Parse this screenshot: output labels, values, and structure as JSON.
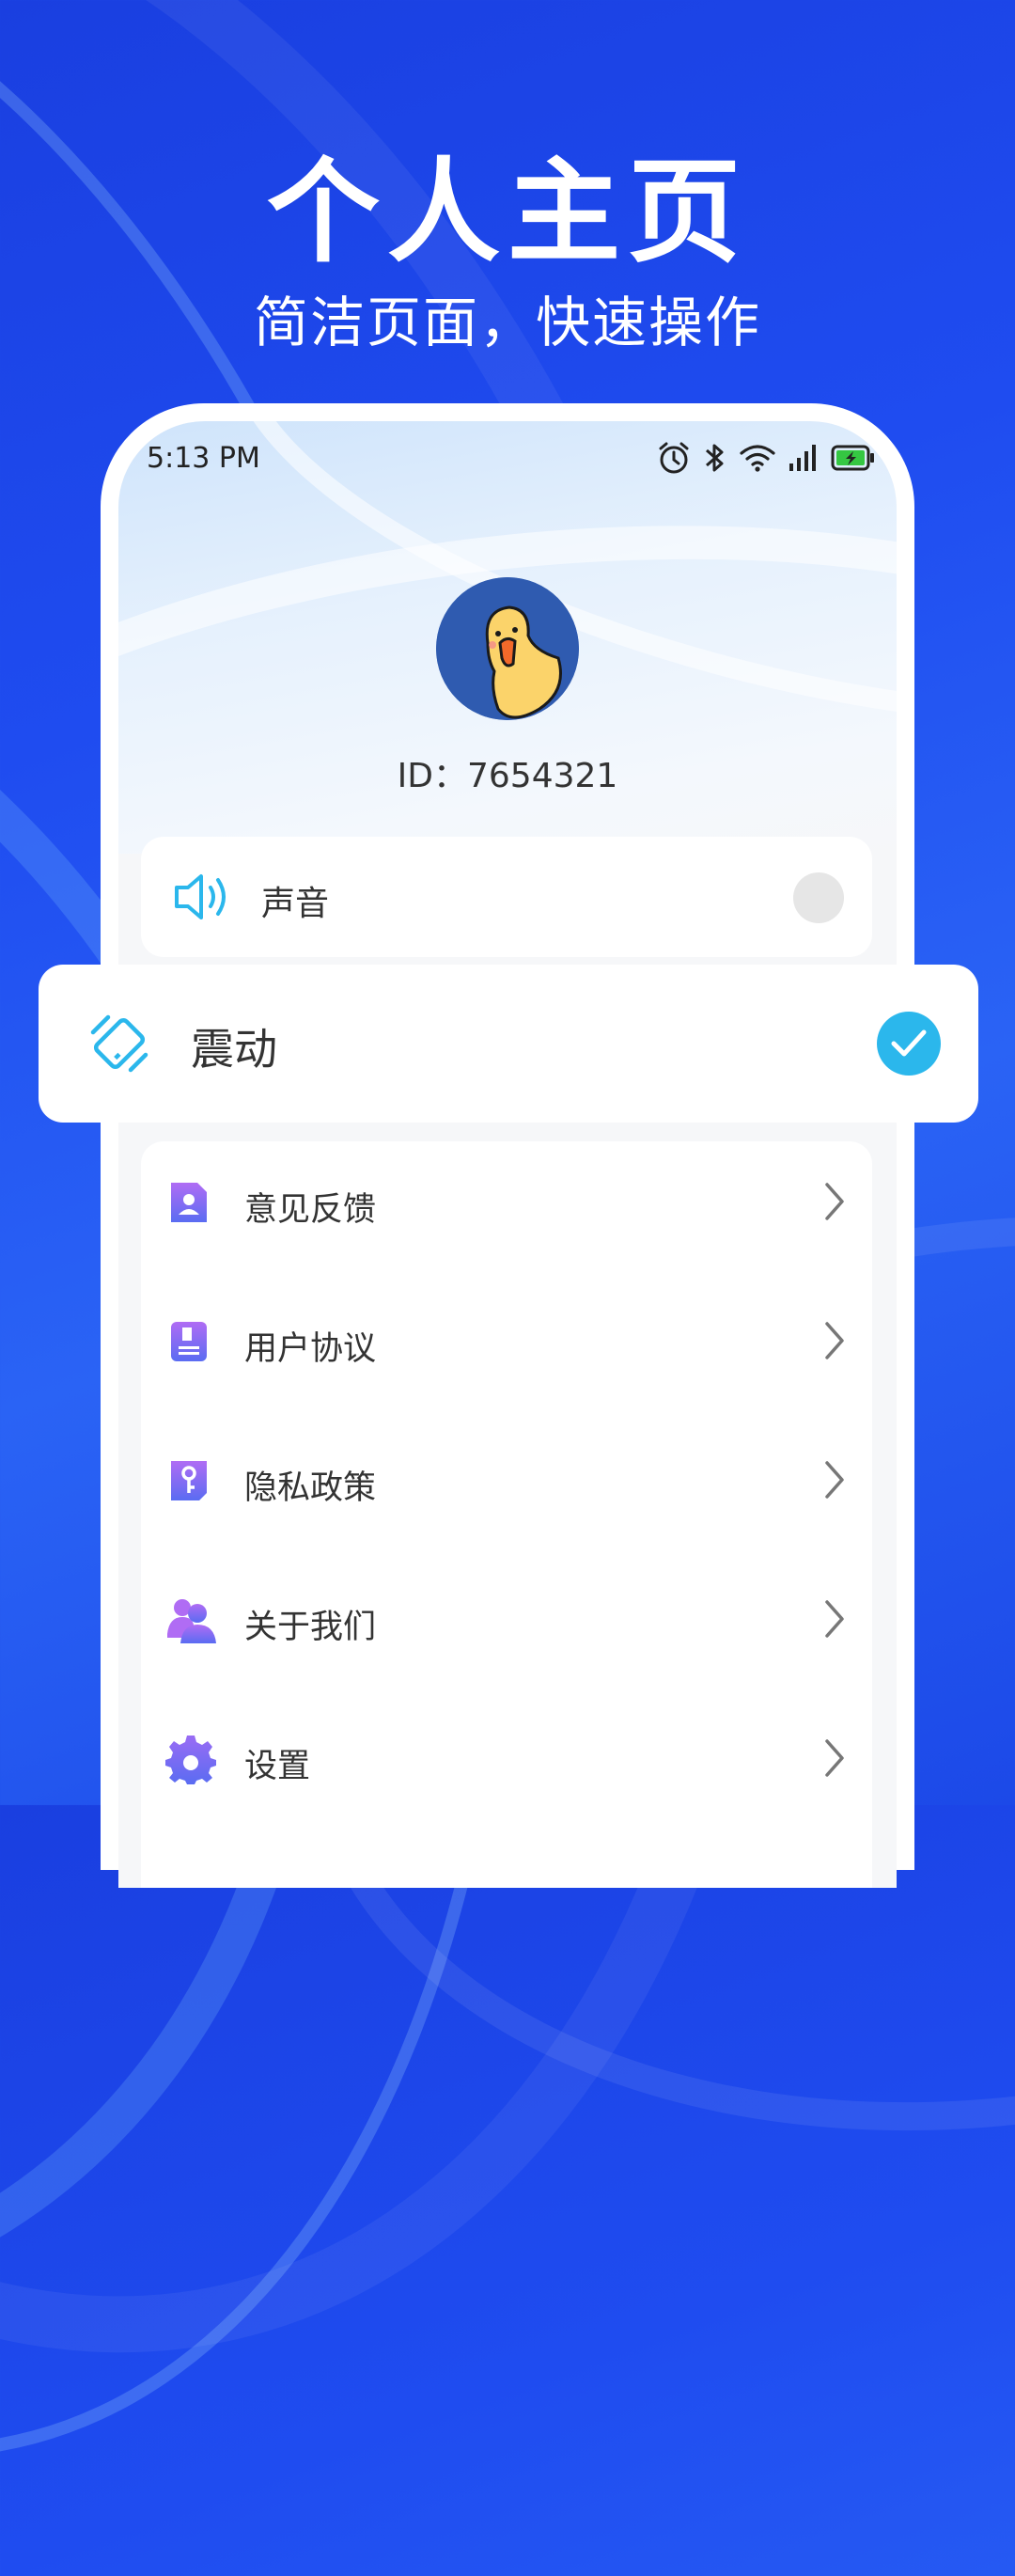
{
  "hero": {
    "title": "个人主页",
    "subtitle": "简洁页面，快速操作"
  },
  "status_bar": {
    "time": "5:13 PM",
    "icons": [
      "alarm-icon",
      "bluetooth-icon",
      "wifi-icon",
      "signal-icon",
      "battery-icon"
    ]
  },
  "profile": {
    "id_label": "ID：7654321"
  },
  "settings": {
    "sound": {
      "label": "声音",
      "enabled": false
    },
    "vibration": {
      "label": "震动",
      "enabled": true
    }
  },
  "menu": [
    {
      "label": "意见反馈",
      "icon": "feedback-icon"
    },
    {
      "label": "用户协议",
      "icon": "user-agreement-icon"
    },
    {
      "label": "隐私政策",
      "icon": "privacy-policy-icon"
    },
    {
      "label": "关于我们",
      "icon": "about-us-icon"
    },
    {
      "label": "设置",
      "icon": "settings-gear-icon"
    }
  ],
  "colors": {
    "background": "#1f4cf0",
    "accent": "#2bb7ec",
    "icon_purple": "#7a5cf0",
    "text": "#333333"
  }
}
